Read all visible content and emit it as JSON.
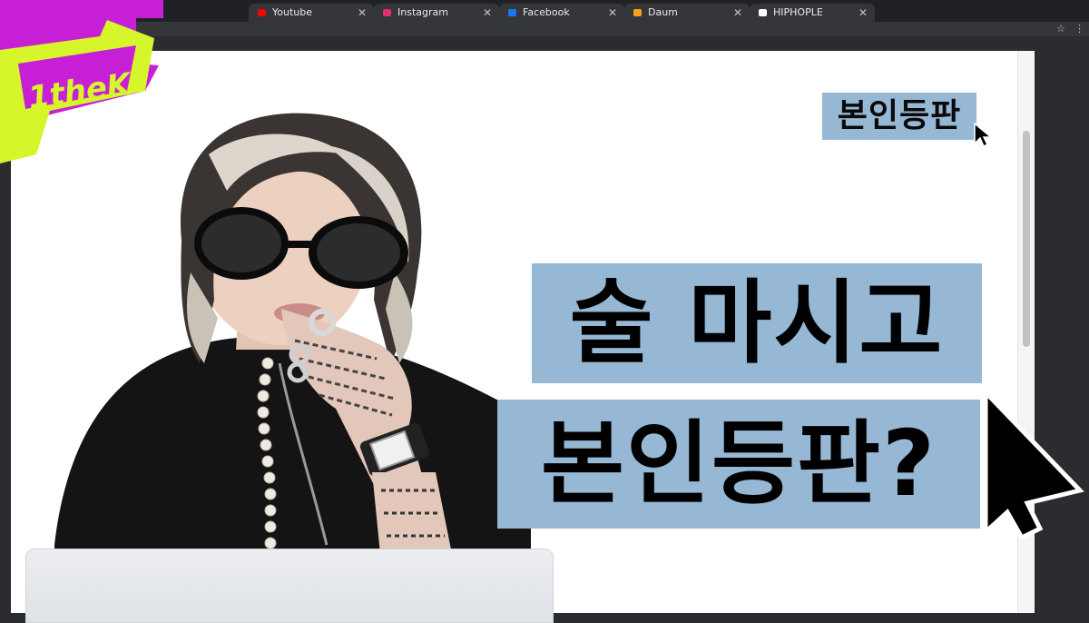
{
  "browser": {
    "tabs": [
      {
        "label": "Youtube",
        "icon": "youtube-icon",
        "color": "#ff0000"
      },
      {
        "label": "Instagram",
        "icon": "instagram-icon",
        "color": "#e1306c"
      },
      {
        "label": "Facebook",
        "icon": "facebook-icon",
        "color": "#1877f2"
      },
      {
        "label": "Daum",
        "icon": "daum-icon",
        "color": "#ff9e1b"
      },
      {
        "label": "HIPHOPLE",
        "icon": "hiphople-icon",
        "color": "#ffffff"
      }
    ],
    "close_glyph": "✕",
    "star_glyph": "☆",
    "menu_glyph": "⋮"
  },
  "logo": {
    "text": "1theK",
    "colors": {
      "purple": "#c71fd6",
      "lime": "#d7f52b"
    }
  },
  "thumbnail": {
    "tag": "본인등판",
    "headline_line1": "술 마시고",
    "headline_line2": "본인등판?",
    "accent_color": "#96b8d4"
  }
}
